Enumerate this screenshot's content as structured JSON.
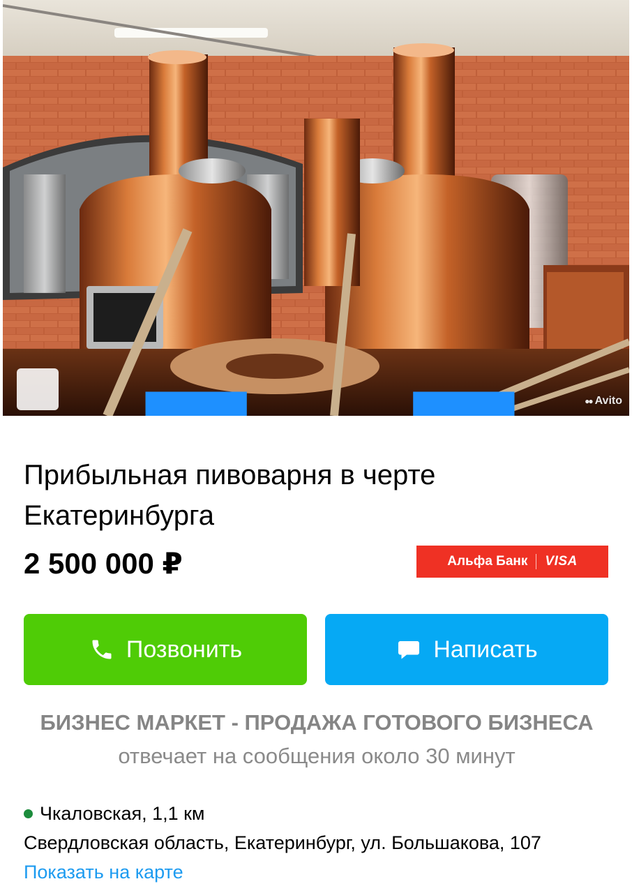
{
  "photo": {
    "watermark": "Avito",
    "icons": {
      "gallery": "expand-gallery-icon"
    }
  },
  "listing": {
    "title": "Прибыльная пивоварня в черте Екатеринбурга",
    "price": "2 500 000 ₽"
  },
  "banner": {
    "bank": "Альфа Банк",
    "card": "VISA",
    "color": "#ef3124"
  },
  "actions": {
    "call_label": "Позвонить",
    "call_color": "#4fcc06",
    "call_icon": "phone-icon",
    "write_label": "Написать",
    "write_color": "#06a9f4",
    "write_icon": "chat-bubble-icon"
  },
  "seller": {
    "name": "БИЗНЕС МАРКЕТ - ПРОДАЖА ГОТОВОГО БИЗНЕСА",
    "response": "отвечает на сообщения около 30 минут"
  },
  "location": {
    "metro": "Чкаловская, 1,1 км",
    "metro_color": "#1c8c3c",
    "address": "Свердловская область, Екатеринбург, ул. Большакова, 107",
    "map_link": "Показать на карте"
  }
}
